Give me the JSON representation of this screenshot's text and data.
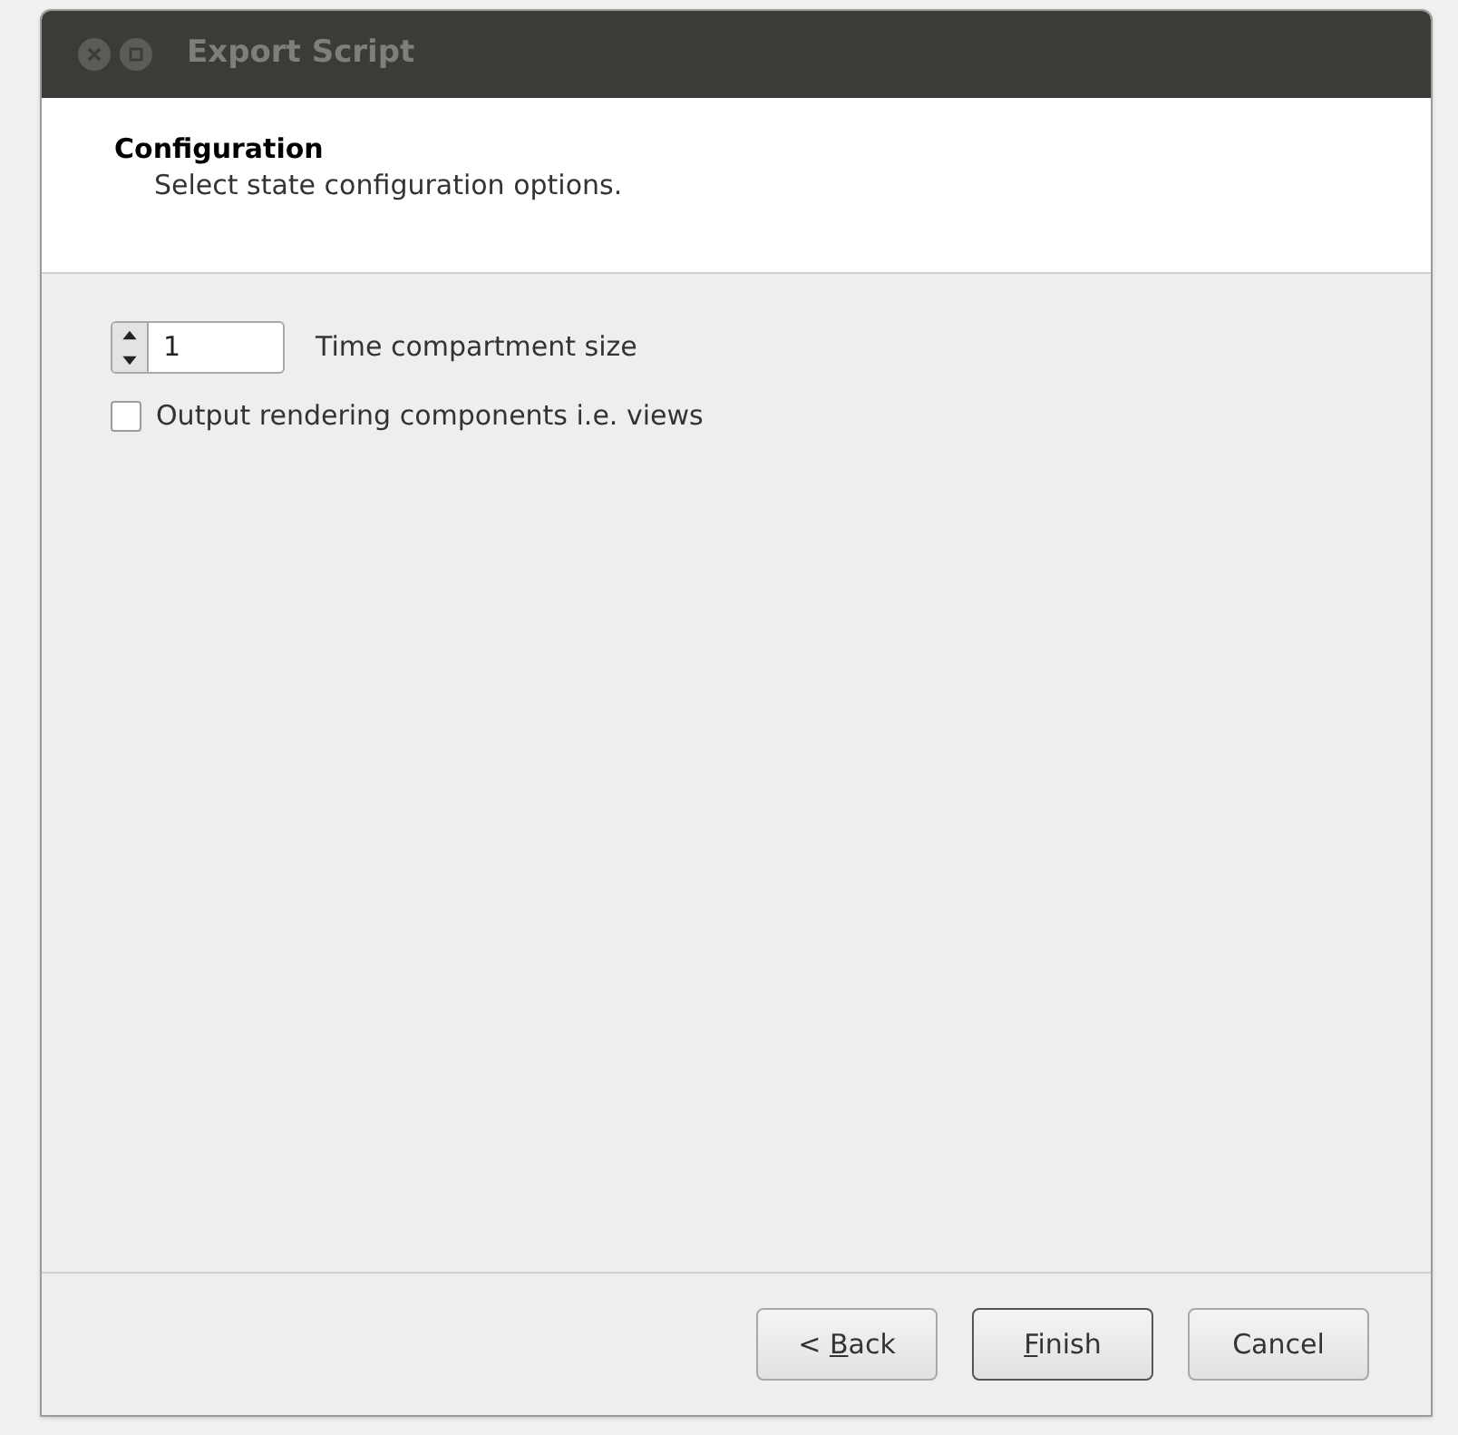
{
  "window": {
    "title": "Export Script"
  },
  "header": {
    "title": "Configuration",
    "subtitle": "Select state configuration options."
  },
  "spinner": {
    "value": "1",
    "label": "Time compartment size"
  },
  "checkbox": {
    "label": "Output rendering components i.e. views",
    "checked": false
  },
  "buttons": [
    {
      "pre": "< ",
      "key": "B",
      "post": "ack",
      "default": false
    },
    {
      "key": "F",
      "post": "inish",
      "default": true
    },
    {
      "pre": "Cancel",
      "default": false
    }
  ]
}
